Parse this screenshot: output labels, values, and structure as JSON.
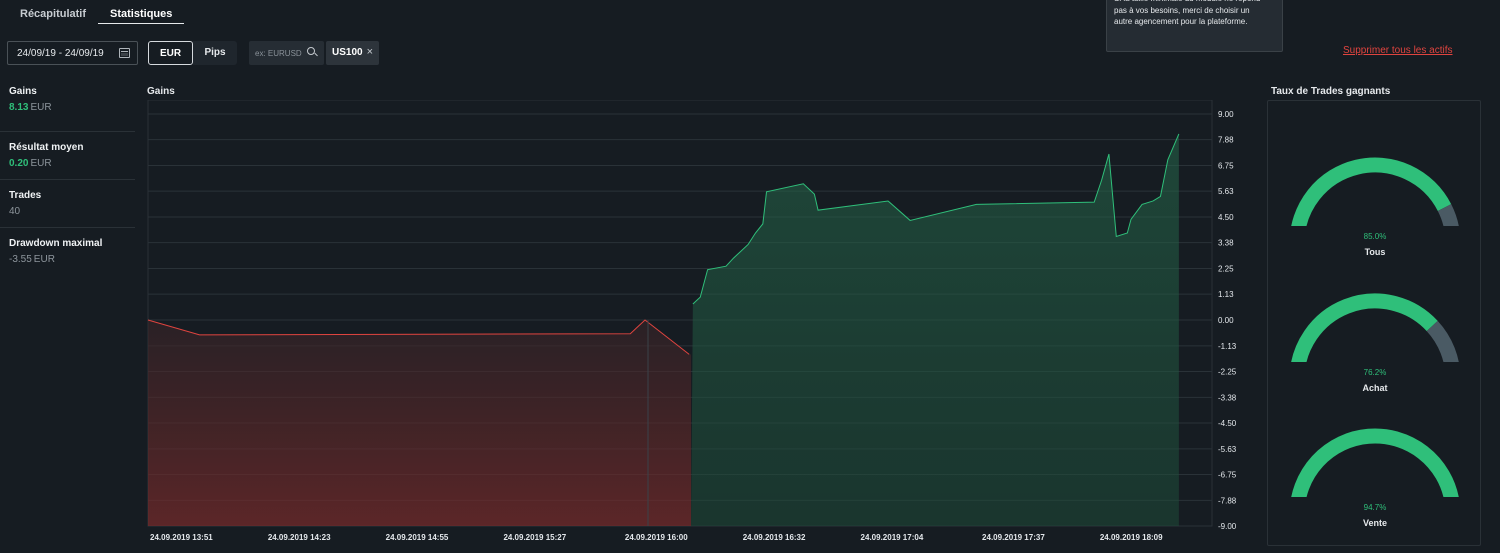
{
  "tabs": [
    {
      "label": "Récapitulatif",
      "active": false
    },
    {
      "label": "Statistiques",
      "active": true
    }
  ],
  "toolbar": {
    "date_range": "24/09/19 - 24/09/19",
    "unit_eur": "EUR",
    "unit_pips": "Pips",
    "selected_unit": "EUR",
    "search_placeholder": "ex: EURUSD",
    "asset_chip": "US100",
    "remove_all": "Supprimer tous les actifs"
  },
  "tooltip": {
    "text": "Si la taille minimale du module ne répond pas à vos besoins, merci de choisir un autre agencement pour la plateforme.",
    "close": "×"
  },
  "stats": [
    {
      "label": "Gains",
      "value": "8.13",
      "unit": "EUR",
      "tone": "pos"
    },
    {
      "label": "Résultat moyen",
      "value": "0.20",
      "unit": "EUR",
      "tone": "pos"
    },
    {
      "label": "Trades",
      "value": "40",
      "unit": "",
      "tone": "neutral"
    },
    {
      "label": "Drawdown maximal",
      "value": "-3.55",
      "unit": "EUR",
      "tone": "neutral"
    }
  ],
  "chart_title": "Gains",
  "chart_data": {
    "type": "area",
    "ylim": [
      -9.0,
      9.0
    ],
    "yticks": [
      "9.00",
      "7.88",
      "6.75",
      "5.63",
      "4.50",
      "3.38",
      "2.25",
      "1.13",
      "0.00",
      "-1.13",
      "-2.25",
      "-3.38",
      "-4.50",
      "-5.63",
      "-6.75",
      "-7.88",
      "-9.00"
    ],
    "xticks": [
      "24.09.2019 13:51",
      "24.09.2019 14:23",
      "24.09.2019 14:55",
      "24.09.2019 15:27",
      "24.09.2019 16:00",
      "24.09.2019 16:32",
      "24.09.2019 17:04",
      "24.09.2019 17:37",
      "24.09.2019 18:09"
    ],
    "x_start": "24.09.2019 13:51",
    "x_end": "24.09.2019 18:40",
    "points": [
      [
        "24.09.2019 13:51",
        0.0
      ],
      [
        "24.09.2019 14:05",
        -0.65
      ],
      [
        "24.09.2019 16:02",
        -0.6
      ],
      [
        "24.09.2019 16:06",
        0.0
      ],
      [
        "24.09.2019 16:18",
        -1.5
      ],
      [
        "24.09.2019 16:19",
        0.7
      ],
      [
        "24.09.2019 16:21",
        1.0
      ],
      [
        "24.09.2019 16:23",
        2.2
      ],
      [
        "24.09.2019 16:28",
        2.35
      ],
      [
        "24.09.2019 16:30",
        2.7
      ],
      [
        "24.09.2019 16:32",
        3.0
      ],
      [
        "24.09.2019 16:34",
        3.3
      ],
      [
        "24.09.2019 16:36",
        3.8
      ],
      [
        "24.09.2019 16:38",
        4.2
      ],
      [
        "24.09.2019 16:39",
        5.6
      ],
      [
        "24.09.2019 16:49",
        5.95
      ],
      [
        "24.09.2019 16:52",
        5.5
      ],
      [
        "24.09.2019 16:53",
        4.8
      ],
      [
        "24.09.2019 17:12",
        5.2
      ],
      [
        "24.09.2019 17:18",
        4.35
      ],
      [
        "24.09.2019 17:36",
        5.05
      ],
      [
        "24.09.2019 18:08",
        5.15
      ],
      [
        "24.09.2019 18:10",
        6.1
      ],
      [
        "24.09.2019 18:12",
        7.25
      ],
      [
        "24.09.2019 18:14",
        3.65
      ],
      [
        "24.09.2019 18:17",
        3.8
      ],
      [
        "24.09.2019 18:18",
        4.4
      ],
      [
        "24.09.2019 18:21",
        5.05
      ],
      [
        "24.09.2019 18:24",
        5.2
      ],
      [
        "24.09.2019 18:26",
        5.4
      ],
      [
        "24.09.2019 18:28",
        7.0
      ],
      [
        "24.09.2019 18:31",
        8.13
      ]
    ],
    "positive_color": "#2fbf7a",
    "negative_color": "#e0443f",
    "grid": true
  },
  "gauges_title": "Taux de Trades gagnants",
  "gauges": [
    {
      "label": "Tous",
      "value": 85.0,
      "pct_text": "85.0%"
    },
    {
      "label": "Achat",
      "value": 76.2,
      "pct_text": "76.2%"
    },
    {
      "label": "Vente",
      "value": 94.7,
      "pct_text": "94.7%"
    }
  ],
  "colors": {
    "background": "#161c22",
    "positive": "#2fbf7a",
    "negative": "#e0443f",
    "gauge_rest": "#4a5a64"
  }
}
